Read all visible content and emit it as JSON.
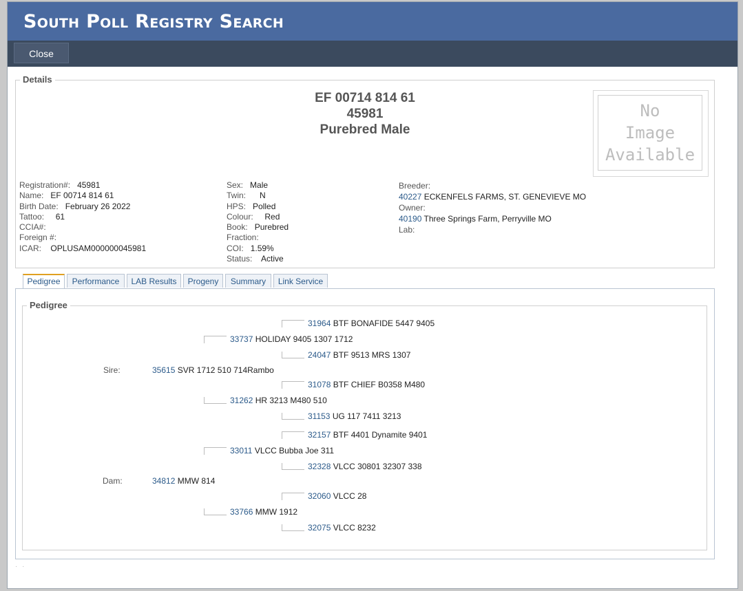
{
  "window": {
    "title": "South Poll Registry Search",
    "close_label": "Close"
  },
  "details": {
    "legend": "Details",
    "heading": {
      "line1": "EF 00714 814 61",
      "line2": "45981",
      "line3": "Purebred Male"
    },
    "no_image_text": [
      "No",
      "Image",
      "Available"
    ],
    "col1": [
      {
        "label": "Registration#:",
        "value": "45981"
      },
      {
        "label": "Name:",
        "value": "EF 00714 814 61"
      },
      {
        "label": "Birth Date:",
        "value": "February 26 2022"
      },
      {
        "label": "Tattoo:",
        "value": "61"
      },
      {
        "label": "CCIA#:",
        "value": ""
      },
      {
        "label": "Foreign #:",
        "value": ""
      },
      {
        "label": "ICAR:",
        "value": "OPLUSAM000000045981"
      }
    ],
    "col2": [
      {
        "label": "Sex:",
        "value": "Male"
      },
      {
        "label": "Twin:",
        "value": "N"
      },
      {
        "label": "HPS:",
        "value": "Polled"
      },
      {
        "label": "Colour:",
        "value": "Red"
      },
      {
        "label": "Book:",
        "value": "Purebred"
      },
      {
        "label": "Fraction:",
        "value": ""
      },
      {
        "label": "COI:",
        "value": "1.59%"
      },
      {
        "label": "Status:",
        "value": "Active"
      }
    ],
    "col3": {
      "breeder_label": "Breeder:",
      "breeder_id": "40227",
      "breeder_name": "ECKENFELS FARMS, ST. GENEVIEVE MO",
      "owner_label": "Owner:",
      "owner_id": "40190",
      "owner_name": "Three Springs Farm, Perryville MO",
      "lab_label": "Lab:"
    }
  },
  "tabs": [
    "Pedigree",
    "Performance",
    "LAB Results",
    "Progeny",
    "Summary",
    "Link Service"
  ],
  "active_tab": "Pedigree",
  "pedigree": {
    "legend": "Pedigree",
    "sire_label": "Sire:",
    "dam_label": "Dam:",
    "sire": {
      "id": "35615",
      "name": "SVR 1712 510 714Rambo"
    },
    "sire_sire": {
      "id": "33737",
      "name": "HOLIDAY 9405 1307 1712"
    },
    "sire_sire_sire": {
      "id": "31964",
      "name": "BTF BONAFIDE 5447 9405"
    },
    "sire_sire_dam": {
      "id": "24047",
      "name": "BTF 9513 MRS 1307"
    },
    "sire_dam": {
      "id": "31262",
      "name": "HR 3213 M480 510"
    },
    "sire_dam_sire": {
      "id": "31078",
      "name": "BTF CHIEF B0358 M480"
    },
    "sire_dam_dam": {
      "id": "31153",
      "name": "UG 117 7411 3213"
    },
    "dam": {
      "id": "34812",
      "name": "MMW 814"
    },
    "dam_sire": {
      "id": "33011",
      "name": "VLCC Bubba Joe 311"
    },
    "dam_sire_sire": {
      "id": "32157",
      "name": "BTF 4401 Dynamite 9401"
    },
    "dam_sire_dam": {
      "id": "32328",
      "name": "VLCC 30801 32307 338"
    },
    "dam_dam": {
      "id": "33766",
      "name": "MMW 1912"
    },
    "dam_dam_sire": {
      "id": "32060",
      "name": "VLCC 28"
    },
    "dam_dam_dam": {
      "id": "32075",
      "name": "VLCC 8232"
    }
  }
}
